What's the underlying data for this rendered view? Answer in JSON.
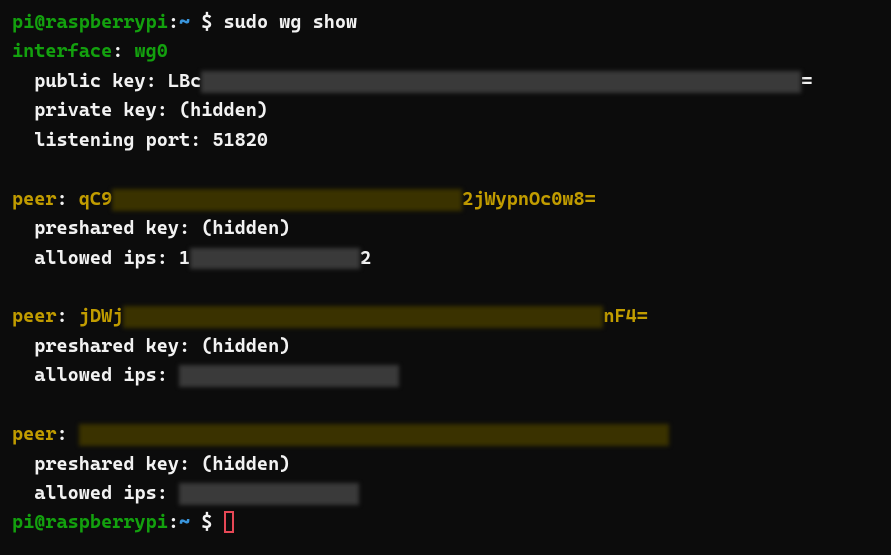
{
  "prompt": {
    "user_host": "pi@raspberrypi",
    "separator": ":",
    "path": "~",
    "symbol": " $"
  },
  "command": " sudo wg show",
  "interface": {
    "label": "interface",
    "name": "wg0",
    "public_key_label": "public key",
    "public_key_prefix": "LBc",
    "public_key_suffix": "=",
    "private_key_label": "private key",
    "private_key_value": "(hidden)",
    "listening_port_label": "listening port",
    "listening_port_value": "51820"
  },
  "peers": [
    {
      "label": "peer",
      "key_prefix": "qC9",
      "key_suffix": "2jWypnOc0w8=",
      "preshared_key_label": "preshared key",
      "preshared_key_value": "(hidden)",
      "allowed_ips_label": "allowed ips",
      "allowed_ips_prefix": "1",
      "allowed_ips_suffix": "2"
    },
    {
      "label": "peer",
      "key_prefix": "jDWj",
      "key_suffix": "nF4=",
      "preshared_key_label": "preshared key",
      "preshared_key_value": "(hidden)",
      "allowed_ips_label": "allowed ips",
      "allowed_ips_prefix": "",
      "allowed_ips_suffix": ""
    },
    {
      "label": "peer",
      "key_prefix": "",
      "key_suffix": "",
      "preshared_key_label": "preshared key",
      "preshared_key_value": "(hidden)",
      "allowed_ips_label": "allowed ips",
      "allowed_ips_prefix": "",
      "allowed_ips_suffix": ""
    }
  ]
}
